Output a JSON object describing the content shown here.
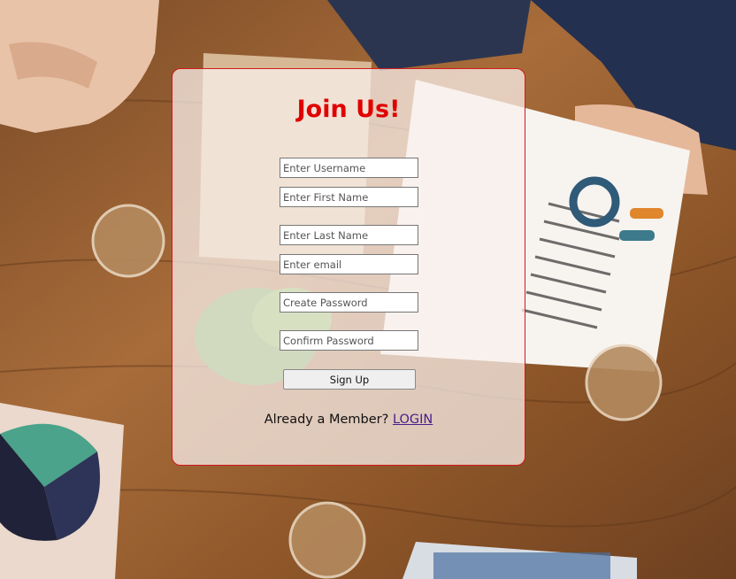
{
  "form": {
    "title": "Join Us!",
    "fields": [
      {
        "placeholder": "Enter Username",
        "value": ""
      },
      {
        "placeholder": "Enter First Name",
        "value": ""
      },
      {
        "placeholder": "Enter Last Name",
        "value": ""
      },
      {
        "placeholder": "Enter email",
        "value": ""
      },
      {
        "placeholder": "Create Password",
        "value": ""
      },
      {
        "placeholder": "Confirm Password",
        "value": ""
      }
    ],
    "submit_label": "Sign Up",
    "member_text": "Already a Member?",
    "login_label": "LOGIN"
  },
  "colors": {
    "title": "#e00000",
    "card_border": "#d01a1a",
    "link": "#4a1c8c"
  }
}
